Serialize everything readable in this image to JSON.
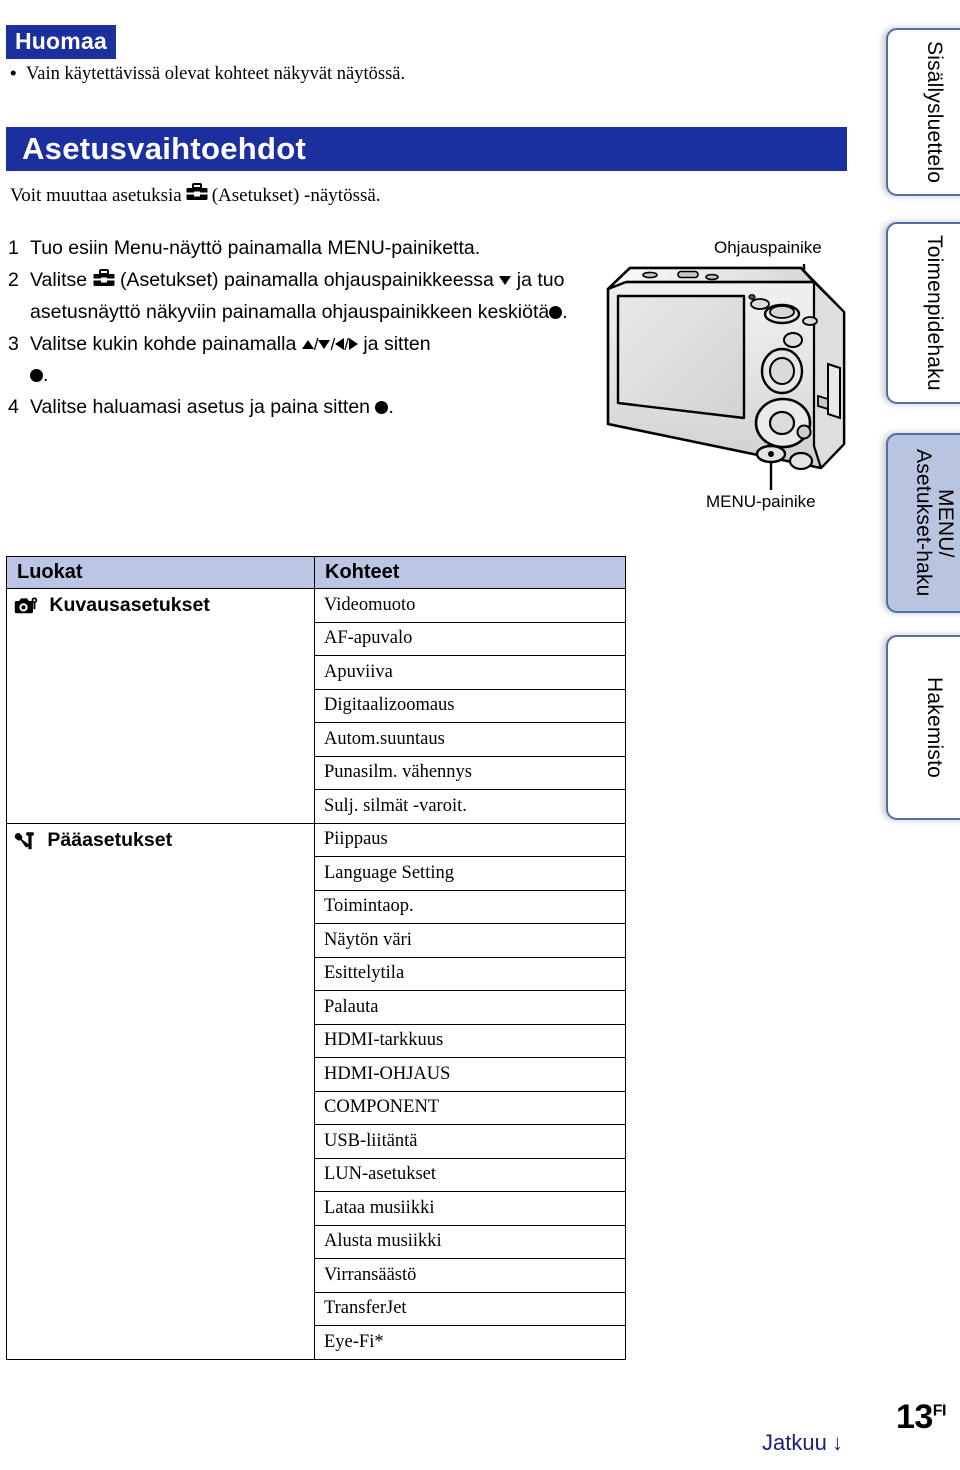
{
  "note": {
    "badge": "Huomaa",
    "bullet_text": "Vain käytettävissä olevat kohteet näkyvät näytössä."
  },
  "section": {
    "title": "Asetusvaihtoehdot",
    "intro_before": "Voit muuttaa asetuksia",
    "intro_icon": "toolbox-icon",
    "intro_after": "(Asetukset) -näytössä."
  },
  "steps": [
    {
      "num": "1",
      "text": "Tuo esiin Menu-näyttö painamalla MENU-painiketta."
    },
    {
      "num": "2",
      "text_a": "Valitse",
      "icon": "toolbox-icon",
      "text_b": "(Asetukset) painamalla ohjauspainikkeessa",
      "glyph_b": "triangle-down-icon",
      "text_c": "ja tuo asetusnäyttö näkyviin painamalla ohjauspainikkeen keskiötä",
      "glyph_c": "filled-circle-icon",
      "text_d": "."
    },
    {
      "num": "3",
      "text_a": "Valitse kukin kohde painamalla",
      "glyphs": [
        "triangle-up-icon",
        "triangle-down-icon",
        "triangle-left-icon",
        "triangle-right-icon"
      ],
      "text_b": "ja sitten",
      "glyph_b": "filled-circle-icon",
      "text_c": "."
    },
    {
      "num": "4",
      "text_a": "Valitse haluamasi asetus ja paina sitten",
      "glyph_b": "filled-circle-icon",
      "text_c": "."
    }
  ],
  "figure": {
    "name": "camera-rear-illustration",
    "label_top": "Ohjauspainike",
    "label_bottom": "MENU-painike"
  },
  "table": {
    "headers": [
      "Luokat",
      "Kohteet"
    ],
    "categories": [
      {
        "icon": "camera-settings-icon",
        "label": "Kuvausasetukset",
        "items": [
          "Videomuoto",
          "AF-apuvalo",
          "Apuviiva",
          "Digitaalizoomaus",
          "Autom.suuntaus",
          "Punasilm. vähennys",
          "Sulj. silmät -varoit."
        ]
      },
      {
        "icon": "tools-icon",
        "label": "Pääasetukset",
        "items": [
          "Piippaus",
          "Language Setting",
          "Toimintaop.",
          "Näytön väri",
          "Esittelytila",
          "Palauta",
          "HDMI-tarkkuus",
          "HDMI-OHJAUS",
          "COMPONENT",
          "USB-liitäntä",
          "LUN-asetukset",
          "Lataa musiikki",
          "Alusta musiikki",
          "Virransäästö",
          "TransferJet",
          "Eye-Fi*"
        ]
      }
    ]
  },
  "side_tabs": [
    {
      "label": "Sisällysluettelo",
      "active": false
    },
    {
      "label": "Toimenpidehaku",
      "active": false
    },
    {
      "label": "MENU/\nAsetukset-haku",
      "active": true
    },
    {
      "label": "Hakemisto",
      "active": false
    }
  ],
  "footer": {
    "page_number": "13",
    "page_suffix": "FI",
    "continue_label": "Jatkuu",
    "continue_arrow": "↓"
  },
  "colors": {
    "brand_blue": "#1c2f9e",
    "table_header": "#bcc6e4",
    "tab_active": "#b9c4e0",
    "tab_border": "#4f6fa5",
    "footer_link": "#1b1f7a"
  }
}
